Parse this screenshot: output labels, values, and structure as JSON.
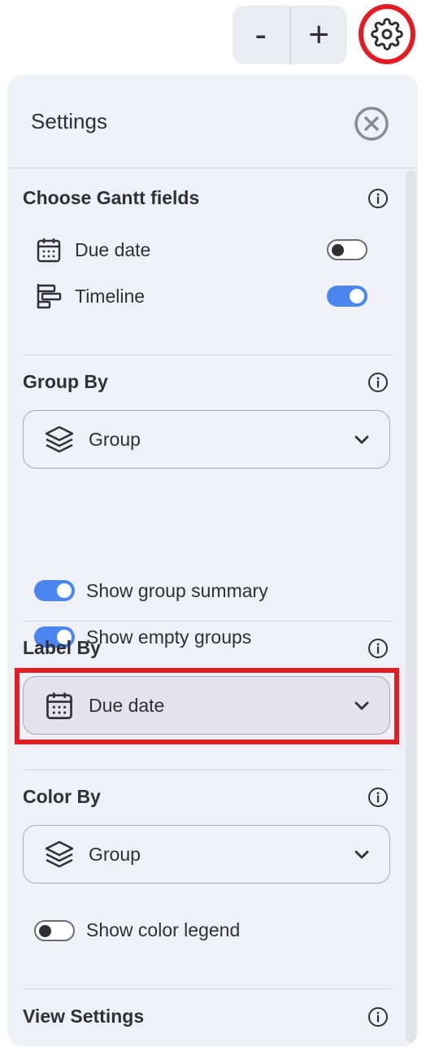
{
  "toolbar": {
    "zoom_out_label": "-",
    "zoom_in_label": "+",
    "settings_icon": "gear-icon"
  },
  "panel": {
    "title": "Settings",
    "close_icon": "close-circle-icon"
  },
  "gantt_fields": {
    "title": "Choose Gantt fields",
    "items": [
      {
        "label": "Due date",
        "icon": "calendar-icon",
        "enabled": false
      },
      {
        "label": "Timeline",
        "icon": "timeline-icon",
        "enabled": true
      }
    ]
  },
  "group_by": {
    "title": "Group By",
    "selected": "Group",
    "icon": "layers-icon",
    "options": [
      {
        "label": "Show group summary",
        "enabled": true
      },
      {
        "label": "Show empty groups",
        "enabled": true
      }
    ]
  },
  "label_by": {
    "title": "Label By",
    "selected": "Due date",
    "icon": "calendar-icon"
  },
  "color_by": {
    "title": "Color By",
    "selected": "Group",
    "icon": "layers-icon",
    "options": [
      {
        "label": "Show color legend",
        "enabled": false
      }
    ]
  },
  "view_settings": {
    "title": "View Settings"
  },
  "colors": {
    "accent": "#4b86f0",
    "highlight": "#e41b23",
    "panel_bg": "#f0f1f7"
  }
}
